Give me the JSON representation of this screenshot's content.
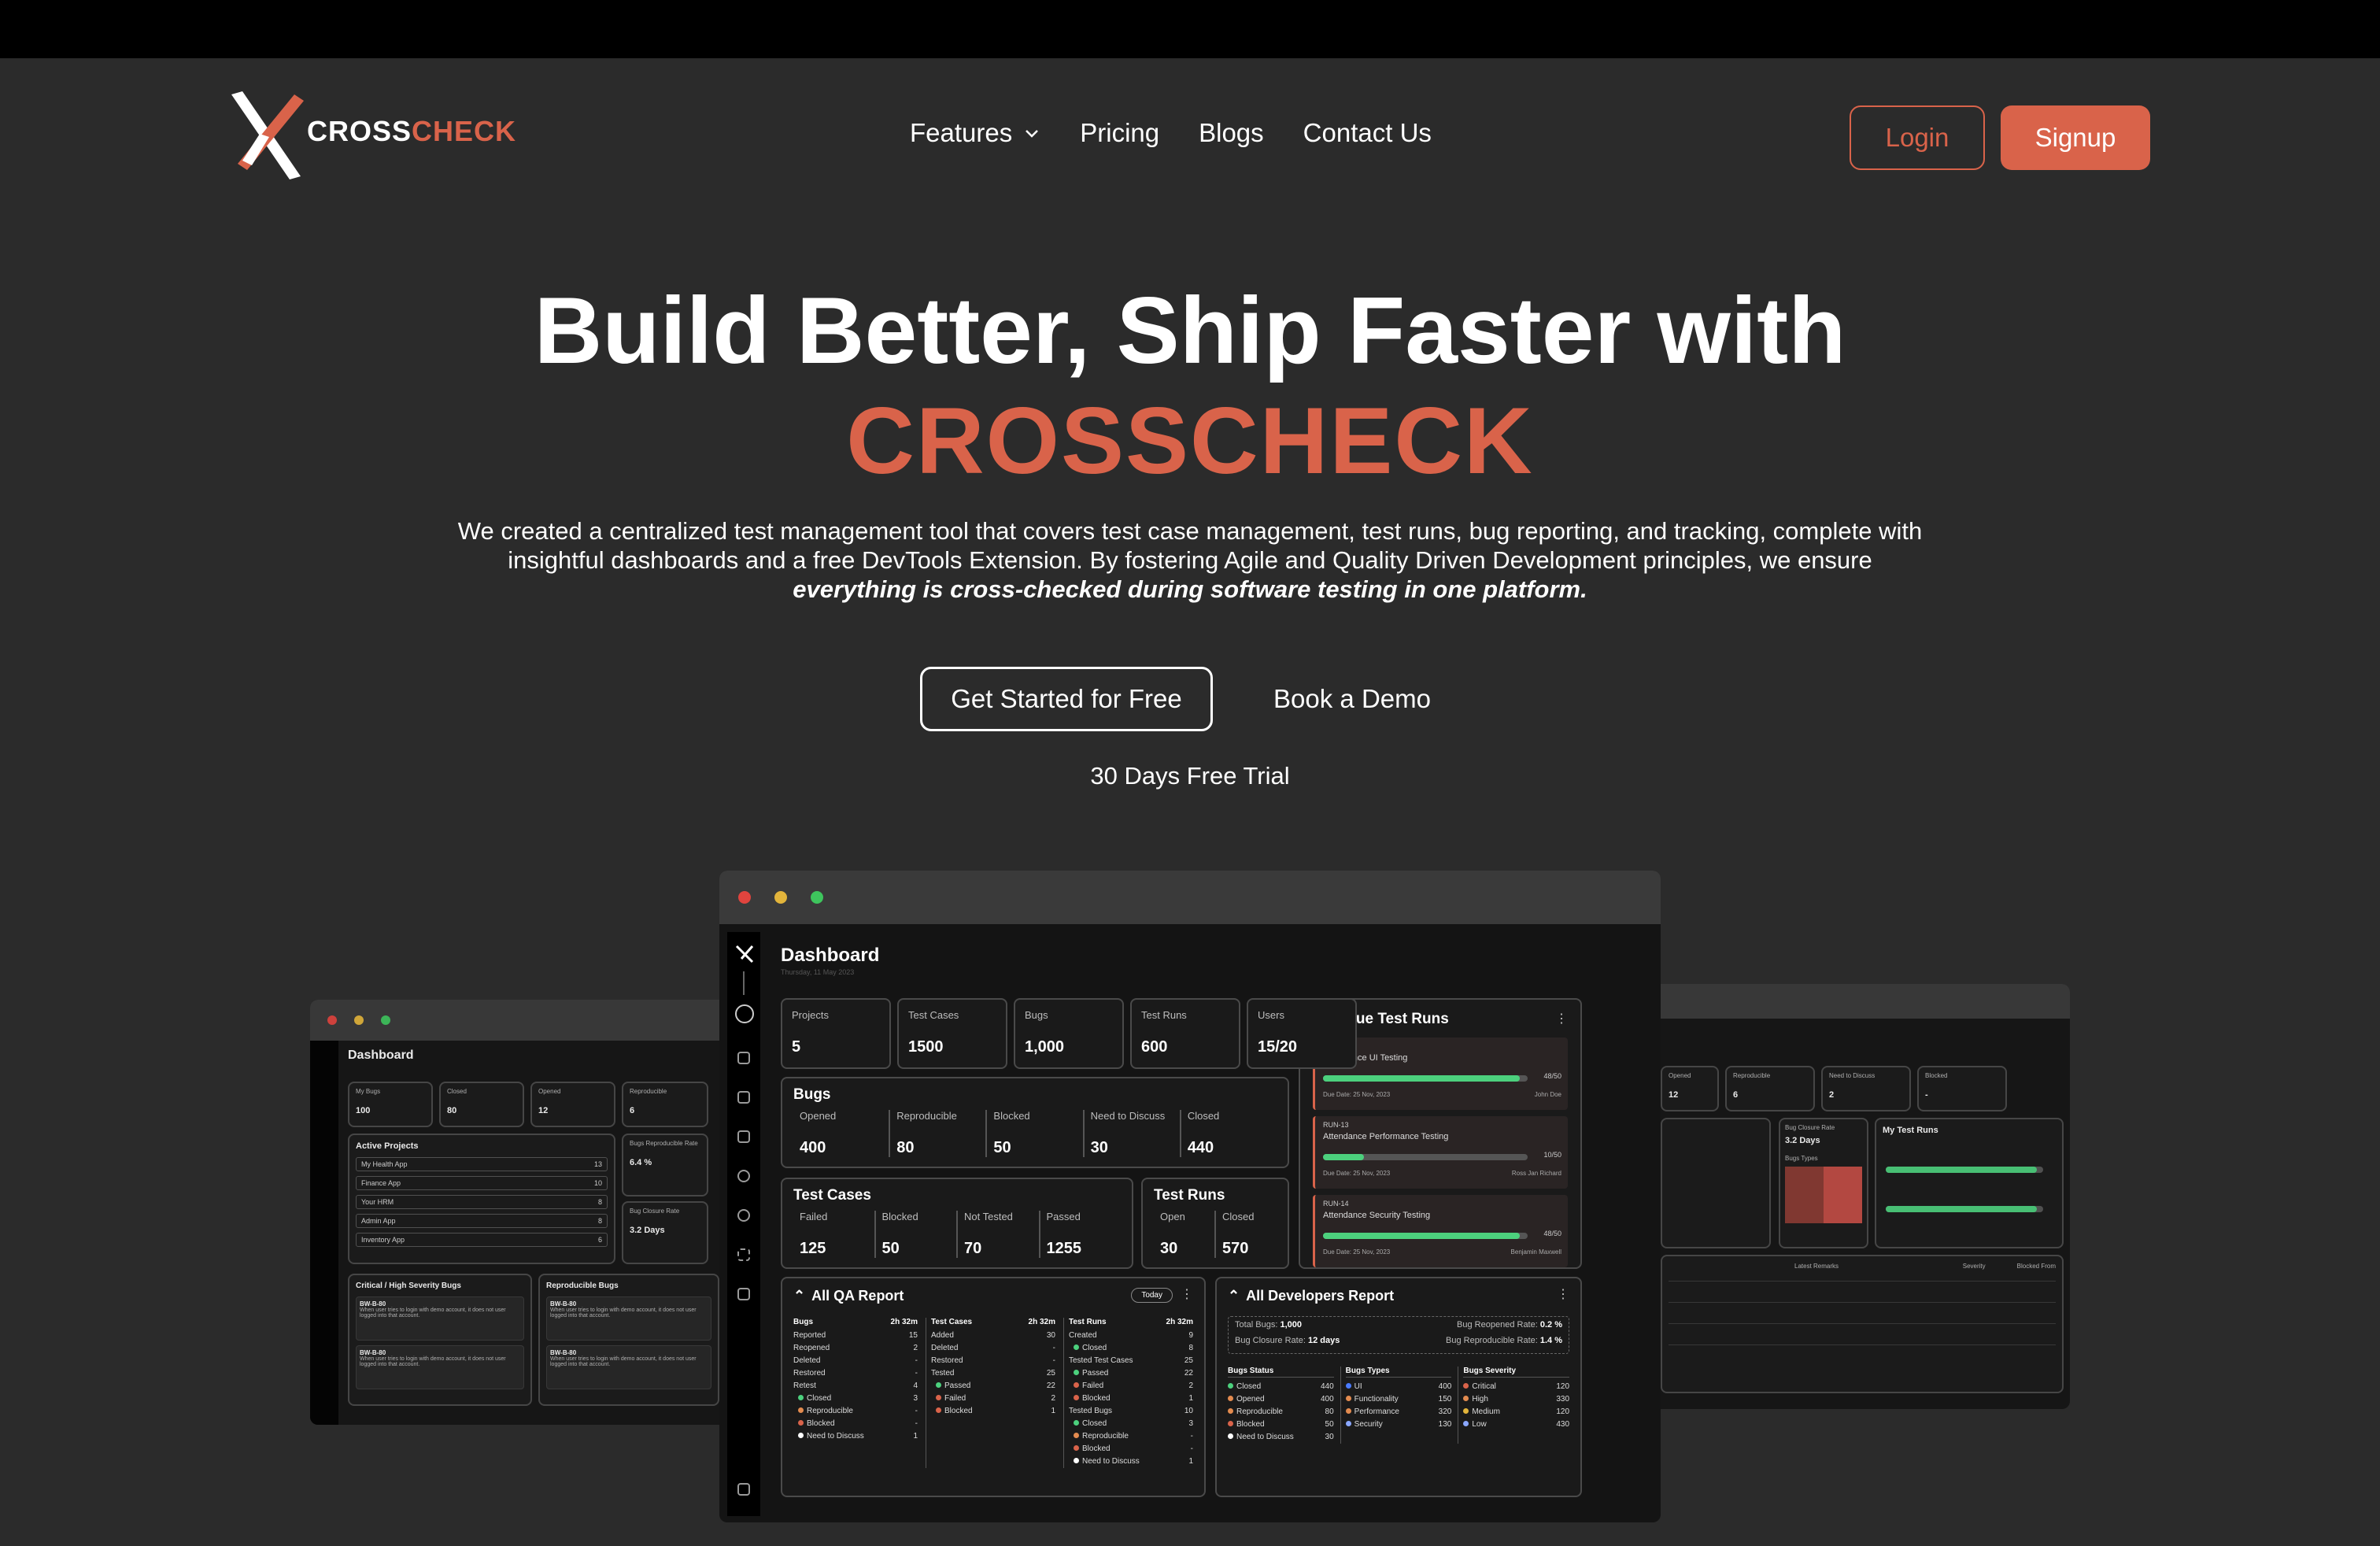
{
  "brand": {
    "name_a": "CROSS",
    "name_b": "CHECK",
    "accent": "#d9634a"
  },
  "nav": {
    "features": "Features",
    "pricing": "Pricing",
    "blogs": "Blogs",
    "contact": "Contact Us"
  },
  "auth": {
    "login": "Login",
    "signup": "Signup"
  },
  "hero": {
    "title_line1": "Build Better, Ship Faster with",
    "title_line2": "CROSSCHECK",
    "desc": "We created a centralized test management tool that covers test case management, test runs, bug reporting, and tracking, complete with insightful dashboards and a free DevTools Extension. By fostering Agile and Quality Driven Development principles, we ensure",
    "desc_em": "everything is cross-checked during software testing in one platform.",
    "cta_primary": "Get Started for Free",
    "cta_secondary": "Book a Demo",
    "trial": "30 Days Free Trial"
  },
  "main_dash": {
    "title": "Dashboard",
    "date": "Thursday, 11 May 2023",
    "stats": [
      {
        "label": "Projects",
        "value": "5"
      },
      {
        "label": "Test Cases",
        "value": "1500"
      },
      {
        "label": "Bugs",
        "value": "1,000"
      },
      {
        "label": "Test Runs",
        "value": "600"
      },
      {
        "label": "Users",
        "value": "15/20"
      }
    ],
    "bugs": {
      "title": "Bugs",
      "items": [
        {
          "label": "Opened",
          "value": "400"
        },
        {
          "label": "Reproducible",
          "value": "80"
        },
        {
          "label": "Blocked",
          "value": "50"
        },
        {
          "label": "Need to Discuss",
          "value": "30"
        },
        {
          "label": "Closed",
          "value": "440"
        }
      ]
    },
    "test_cases": {
      "title": "Test Cases",
      "items": [
        {
          "label": "Failed",
          "value": "125"
        },
        {
          "label": "Blocked",
          "value": "50"
        },
        {
          "label": "Not Tested",
          "value": "70"
        },
        {
          "label": "Passed",
          "value": "1255"
        }
      ]
    },
    "test_runs": {
      "title": "Test Runs",
      "items": [
        {
          "label": "Open",
          "value": "30"
        },
        {
          "label": "Closed",
          "value": "570"
        }
      ]
    },
    "overdue": {
      "title": "Overdue Test Runs",
      "runs": [
        {
          "id": "RUN-12",
          "name": "Attendance UI Testing",
          "progress": "48/50",
          "fraction": 0.96,
          "due": "Due Date: 25 Nov, 2023",
          "user": "John Doe"
        },
        {
          "id": "RUN-13",
          "name": "Attendance Performance Testing",
          "progress": "10/50",
          "fraction": 0.2,
          "due": "Due Date: 25 Nov, 2023",
          "user": "Ross Jan Richard"
        },
        {
          "id": "RUN-14",
          "name": "Attendance Security Testing",
          "progress": "48/50",
          "fraction": 0.96,
          "due": "Due Date: 25 Nov, 2023",
          "user": "Benjamin Maxwell"
        }
      ]
    },
    "qa_report": {
      "title": "All QA Report",
      "badge": "Today",
      "bugs_col": {
        "head": "Bugs",
        "time": "2h 32m",
        "rows": [
          [
            "Reported",
            "15"
          ],
          [
            "Reopened",
            "2"
          ],
          [
            "Deleted",
            "-"
          ],
          [
            "Restored",
            "-"
          ],
          [
            "Retest",
            "4"
          ],
          [
            "Closed",
            "3"
          ],
          [
            "Reproducible",
            "-"
          ],
          [
            "Blocked",
            "-"
          ],
          [
            "Need to Discuss",
            "1"
          ]
        ]
      },
      "tc_col": {
        "head": "Test Cases",
        "time": "2h 32m",
        "rows": [
          [
            "Added",
            "30"
          ],
          [
            "Deleted",
            "-"
          ],
          [
            "Restored",
            "-"
          ],
          [
            "Tested",
            "25"
          ],
          [
            "Passed",
            "22"
          ],
          [
            "Failed",
            "2"
          ],
          [
            "Blocked",
            "1"
          ]
        ]
      },
      "tr_col": {
        "head": "Test Runs",
        "time": "2h 32m",
        "rows": [
          [
            "Created",
            "9"
          ],
          [
            "Closed",
            "8"
          ],
          [
            "Tested Test Cases",
            "25"
          ],
          [
            "Passed",
            "22"
          ],
          [
            "Failed",
            "2"
          ],
          [
            "Blocked",
            "1"
          ],
          [
            "Tested Bugs",
            "10"
          ],
          [
            "Closed",
            "3"
          ],
          [
            "Reproducible",
            "-"
          ],
          [
            "Blocked",
            "-"
          ],
          [
            "Need to Discuss",
            "1"
          ]
        ]
      }
    },
    "dev_report": {
      "title": "All Developers Report",
      "total_bugs_label": "Total Bugs:",
      "total_bugs": "1,000",
      "closure_label": "Bug Closure Rate:",
      "closure": "12 days",
      "reopened_label": "Bug Reopened Rate:",
      "reopened": "0.2 %",
      "repro_label": "Bug Reproducible Rate:",
      "repro": "1.4 %",
      "status": {
        "head": "Bugs Status",
        "rows": [
          [
            "Closed",
            "440"
          ],
          [
            "Opened",
            "400"
          ],
          [
            "Reproducible",
            "80"
          ],
          [
            "Blocked",
            "50"
          ],
          [
            "Need to Discuss",
            "30"
          ]
        ]
      },
      "types": {
        "head": "Bugs Types",
        "rows": [
          [
            "UI",
            "400"
          ],
          [
            "Functionality",
            "150"
          ],
          [
            "Performance",
            "320"
          ],
          [
            "Security",
            "130"
          ]
        ]
      },
      "severity": {
        "head": "Bugs Severity",
        "rows": [
          [
            "Critical",
            "120"
          ],
          [
            "High",
            "330"
          ],
          [
            "Medium",
            "120"
          ],
          [
            "Low",
            "430"
          ]
        ]
      }
    }
  },
  "left_dash": {
    "title": "Dashboard",
    "stats": [
      {
        "label": "My Bugs",
        "value": "100"
      },
      {
        "label": "Closed",
        "value": "80"
      },
      {
        "label": "Opened",
        "value": "12"
      },
      {
        "label": "Reproducible",
        "value": "6"
      }
    ],
    "projects_title": "Active Projects",
    "projects": [
      {
        "name": "My Health App",
        "n": "13"
      },
      {
        "name": "Finance App",
        "n": "10"
      },
      {
        "name": "Your HRM",
        "n": "8"
      },
      {
        "name": "Admin App",
        "n": "8"
      },
      {
        "name": "Inventory App",
        "n": "6"
      }
    ],
    "repro_rate_label": "Bugs Reproducible Rate",
    "repro_rate": "6.4 %",
    "closure_label": "Bug Closure Rate",
    "closure": "3.2 Days",
    "crit_title": "Critical / High Severity Bugs",
    "repro_title": "Reproducible Bugs",
    "bug_id": "BW-B-80",
    "bug_text": "When user tries to login with demo account, it does not user logged into that account."
  },
  "right_dash": {
    "stats": [
      {
        "label": "Opened",
        "value": "12"
      },
      {
        "label": "Reproducible",
        "value": "6"
      },
      {
        "label": "Need to Discuss",
        "value": "2"
      },
      {
        "label": "Blocked",
        "value": "-"
      }
    ],
    "closure_label": "Bug Closure Rate",
    "closure": "3.2 Days",
    "types_label": "Bugs Types",
    "runs_title": "My Test Runs",
    "remarks_label": "Latest Remarks",
    "severity_label": "Severity",
    "blocked_label": "Blocked From"
  }
}
